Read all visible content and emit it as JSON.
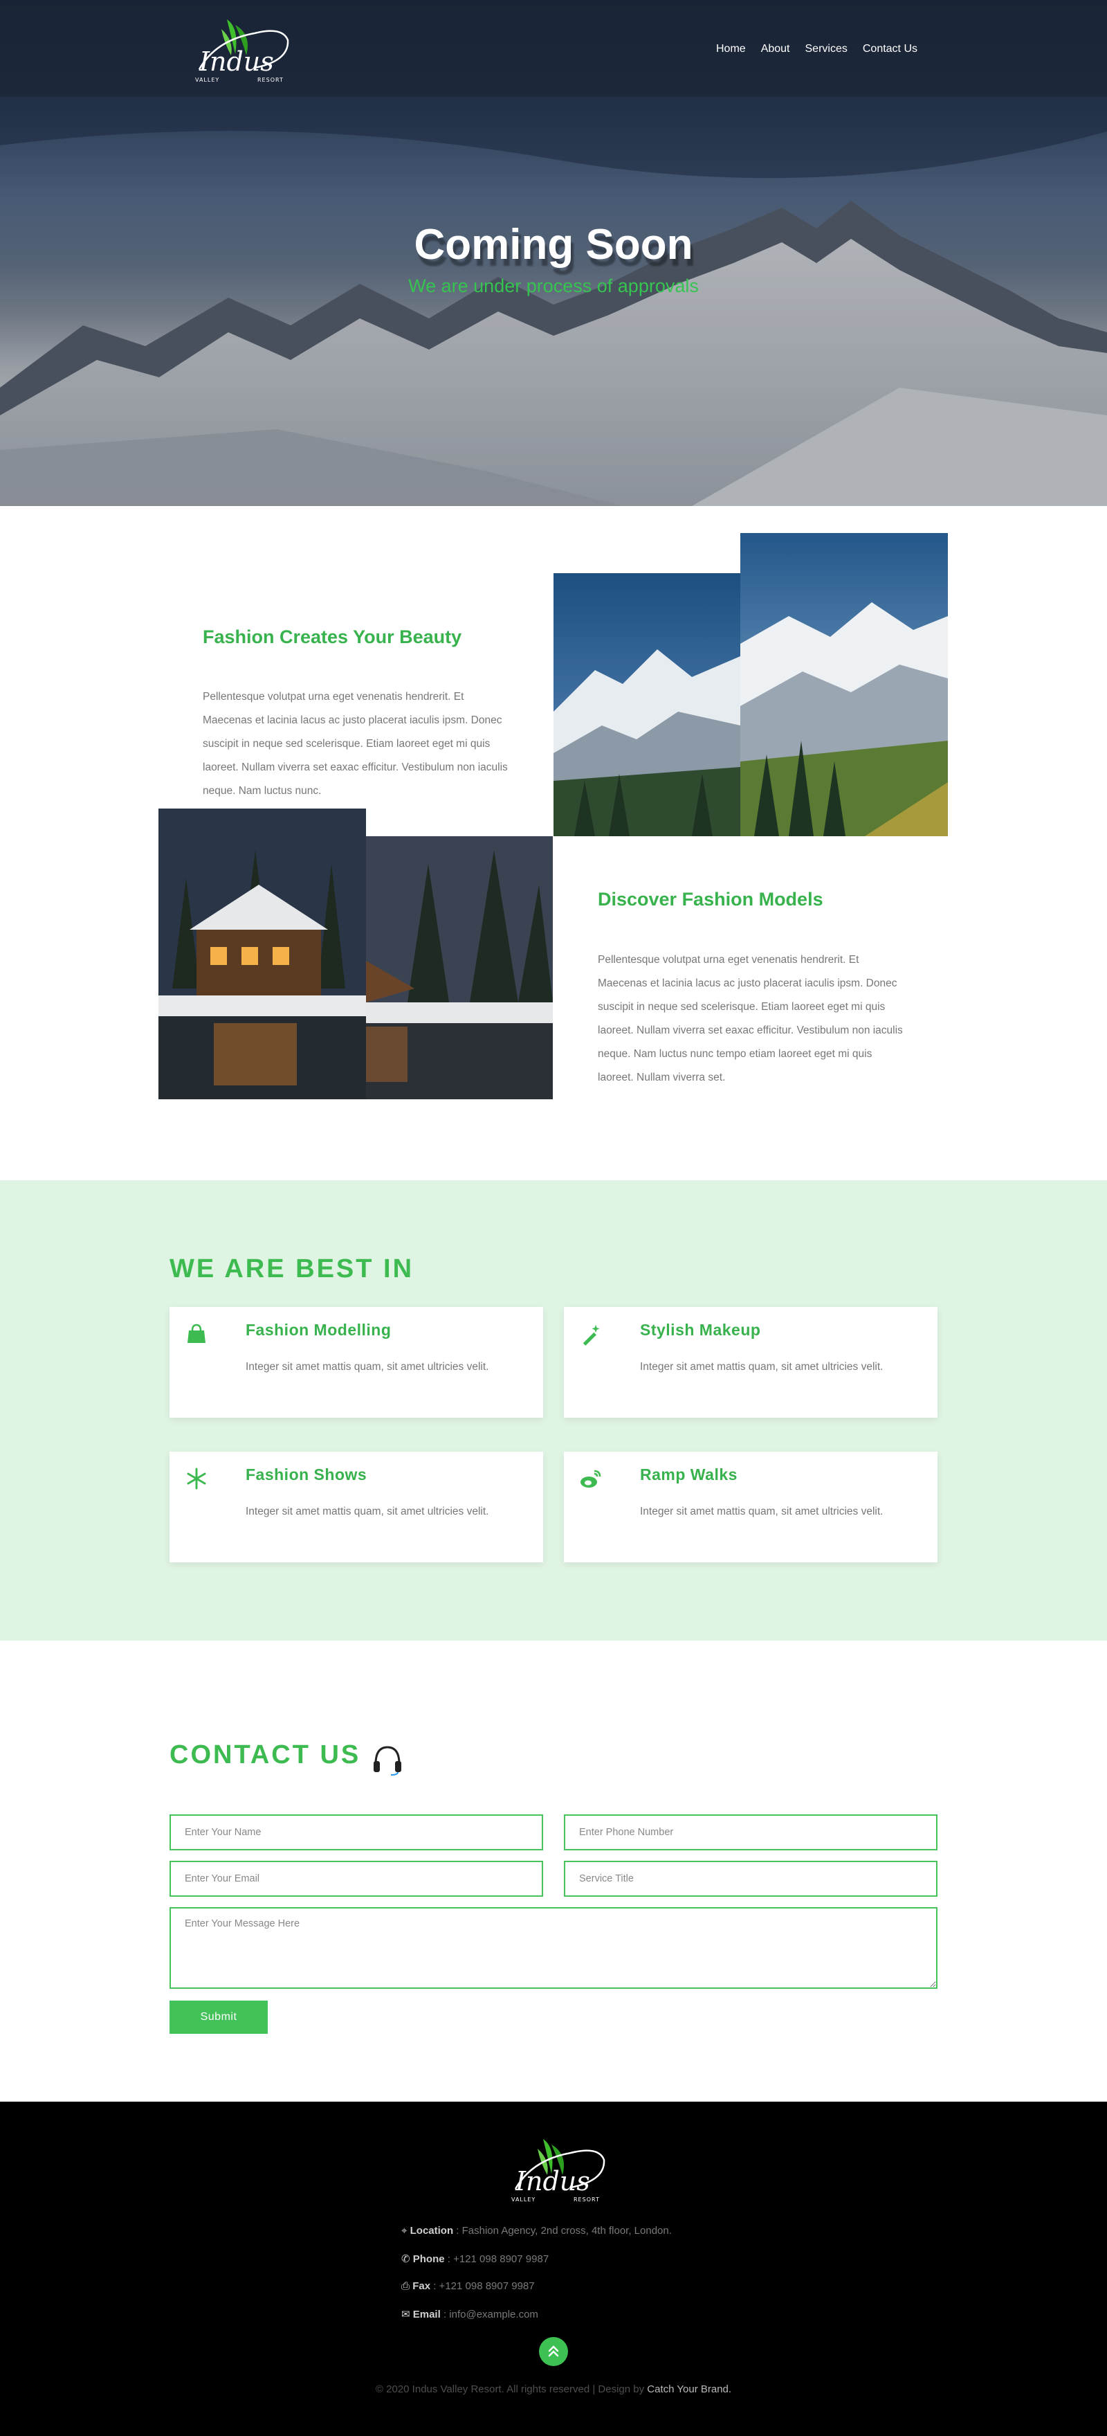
{
  "brand": {
    "logo_text": "Indus",
    "logo_sub_left": "VALLEY",
    "logo_sub_right": "RESORT",
    "accent_color": "#3dbb50"
  },
  "nav": {
    "items": [
      {
        "label": "Home"
      },
      {
        "label": "About"
      },
      {
        "label": "Services"
      },
      {
        "label": "Contact Us"
      }
    ]
  },
  "hero": {
    "title": "Coming Soon",
    "subtitle": "We are under process of approvals"
  },
  "about": {
    "block1": {
      "title": "Fashion Creates Your Beauty",
      "text": "Pellentesque volutpat urna eget venenatis hendrerit. Et Maecenas et lacinia lacus ac justo placerat iaculis ipsm. Donec suscipit in neque sed scelerisque. Etiam laoreet eget mi quis laoreet. Nullam viverra set eaxac efficitur. Vestibulum non iaculis neque. Nam luctus nunc."
    },
    "block2": {
      "title": "Discover Fashion Models",
      "text": "Pellentesque volutpat urna eget venenatis hendrerit. Et Maecenas et lacinia lacus ac justo placerat iaculis ipsm. Donec suscipit in neque sed scelerisque. Etiam laoreet eget mi quis laoreet. Nullam viverra set eaxac efficitur. Vestibulum non iaculis neque. Nam luctus nunc tempo etiam laoreet eget mi quis laoreet. Nullam viverra set."
    }
  },
  "services": {
    "title": "WE ARE BEST IN",
    "cards": [
      {
        "title": "Fashion Modelling",
        "text": "Integer sit amet mattis quam, sit amet ultricies velit.",
        "icon": "shopping-bag-icon"
      },
      {
        "title": "Stylish Makeup",
        "text": "Integer sit amet mattis quam, sit amet ultricies velit.",
        "icon": "magic-wand-icon"
      },
      {
        "title": "Fashion Shows",
        "text": "Integer sit amet mattis quam, sit amet ultricies velit.",
        "icon": "snowflake-icon"
      },
      {
        "title": "Ramp Walks",
        "text": "Integer sit amet mattis quam, sit amet ultricies velit.",
        "icon": "weibo-icon"
      }
    ]
  },
  "contact": {
    "title": "CONTACT US",
    "name_placeholder": "Enter Your Name",
    "phone_placeholder": "Enter Phone Number",
    "email_placeholder": "Enter Your Email",
    "service_placeholder": "Service Title",
    "message_placeholder": "Enter Your Message Here",
    "submit_label": "Submit"
  },
  "footer": {
    "location_label": "Location",
    "location_value": ": Fashion Agency, 2nd cross, 4th floor, London.",
    "phone_label": "Phone",
    "phone_value": ": +121 098 8907 9987",
    "fax_label": "Fax",
    "fax_value": ": +121 098 8907 9987",
    "email_label": "Email",
    "email_value": ": info@example.com",
    "copyright": "© 2020 Indus Valley Resort. All rights reserved | Design by",
    "design_brand": "Catch Your Brand."
  }
}
